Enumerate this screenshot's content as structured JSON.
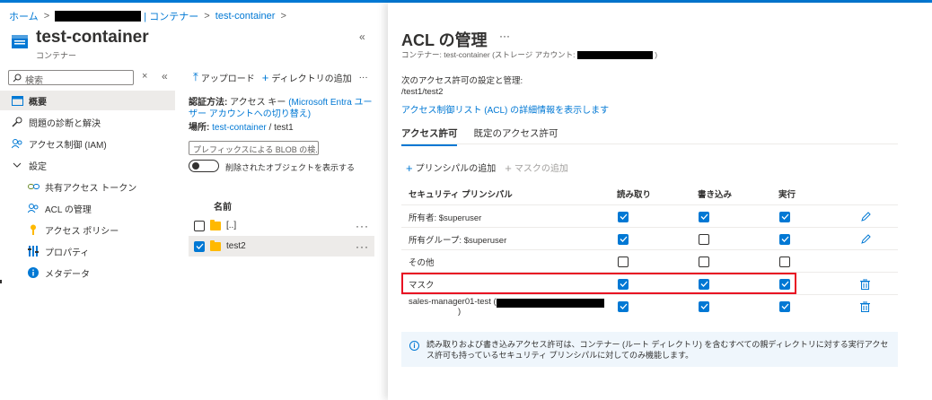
{
  "breadcrumb": {
    "home": "ホーム",
    "separator": ">",
    "container_suffix": "| コンテナー",
    "current": "test-container"
  },
  "header": {
    "title": "test-container",
    "subtitle": "コンテナー",
    "collapse_icon": "double-chevron-left-icon"
  },
  "search": {
    "placeholder": "検索"
  },
  "sidebar": {
    "items": [
      {
        "label": "概要",
        "icon": "overview-icon",
        "active": true
      },
      {
        "label": "問題の診断と解決",
        "icon": "wrench-icon"
      },
      {
        "label": "アクセス制御 (IAM)",
        "icon": "people-icon"
      },
      {
        "label": "設定",
        "icon": "chevron-down-icon"
      },
      {
        "label": "共有アクセス トークン",
        "icon": "link-icon"
      },
      {
        "label": "ACL の管理",
        "icon": "people-icon"
      },
      {
        "label": "アクセス ポリシー",
        "icon": "key-icon"
      },
      {
        "label": "プロパティ",
        "icon": "properties-icon"
      },
      {
        "label": "メタデータ",
        "icon": "info-icon"
      }
    ]
  },
  "toolbar": {
    "upload": "アップロード",
    "add_directory": "ディレクトリの追加",
    "more": "···"
  },
  "auth": {
    "label": "認証方法:",
    "value": "アクセス キー",
    "switch_link": "(Microsoft Entra ユーザー アカウントへの切り替え)"
  },
  "location": {
    "label": "場所:",
    "container": "test-container",
    "sep": "/",
    "folder": "test1"
  },
  "prefix_search": {
    "placeholder": "プレフィックスによる BLOB の検..."
  },
  "toggle": {
    "label": "削除されたオブジェクトを表示する"
  },
  "file_list": {
    "header": "名前",
    "rows": [
      {
        "name": "[..]",
        "checked": false
      },
      {
        "name": "test2",
        "checked": true
      }
    ],
    "more": "···"
  },
  "acl_panel": {
    "title": "ACL の管理",
    "more": "···",
    "subtitle_prefix": "コンテナー: test-container (ストレージ アカウント:",
    "subtitle_suffix": ")",
    "intro": "次のアクセス許可の設定と管理:",
    "path": "/test1/test2",
    "acl_link": "アクセス制御リスト (ACL) の詳細情報を表示します",
    "tabs": [
      {
        "label": "アクセス許可",
        "active": true
      },
      {
        "label": "既定のアクセス許可",
        "active": false
      }
    ],
    "add_principal": "プリンシパルの追加",
    "add_mask": "マスクの追加",
    "columns": [
      "セキュリティ プリンシパル",
      "読み取り",
      "書き込み",
      "実行"
    ],
    "rows": [
      {
        "principal": "所有者: $superuser",
        "read": true,
        "write": true,
        "execute": true,
        "action": "pencil-icon"
      },
      {
        "principal": "所有グループ: $superuser",
        "read": true,
        "write": false,
        "execute": true,
        "action": "pencil-icon"
      },
      {
        "principal": "その他",
        "read": false,
        "write": false,
        "execute": false,
        "action": ""
      },
      {
        "principal": "マスク",
        "read": true,
        "write": true,
        "execute": true,
        "action": "trash-icon"
      },
      {
        "principal": "sales-manager01-test (",
        "principal_suffix": ")",
        "read": true,
        "write": true,
        "execute": true,
        "action": "trash-icon"
      }
    ],
    "info": "読み取りおよび書き込みアクセス許可は、コンテナー (ルート ディレクトリ) を含むすべての親ディレクトリに対する実行アクセス許可も持っているセキュリティ プリンシパルに対してのみ機能します。"
  },
  "colors": {
    "accent": "#0078d4",
    "highlight": "#e81123",
    "folder": "#ffb900",
    "info_bg": "#eff6fc"
  }
}
